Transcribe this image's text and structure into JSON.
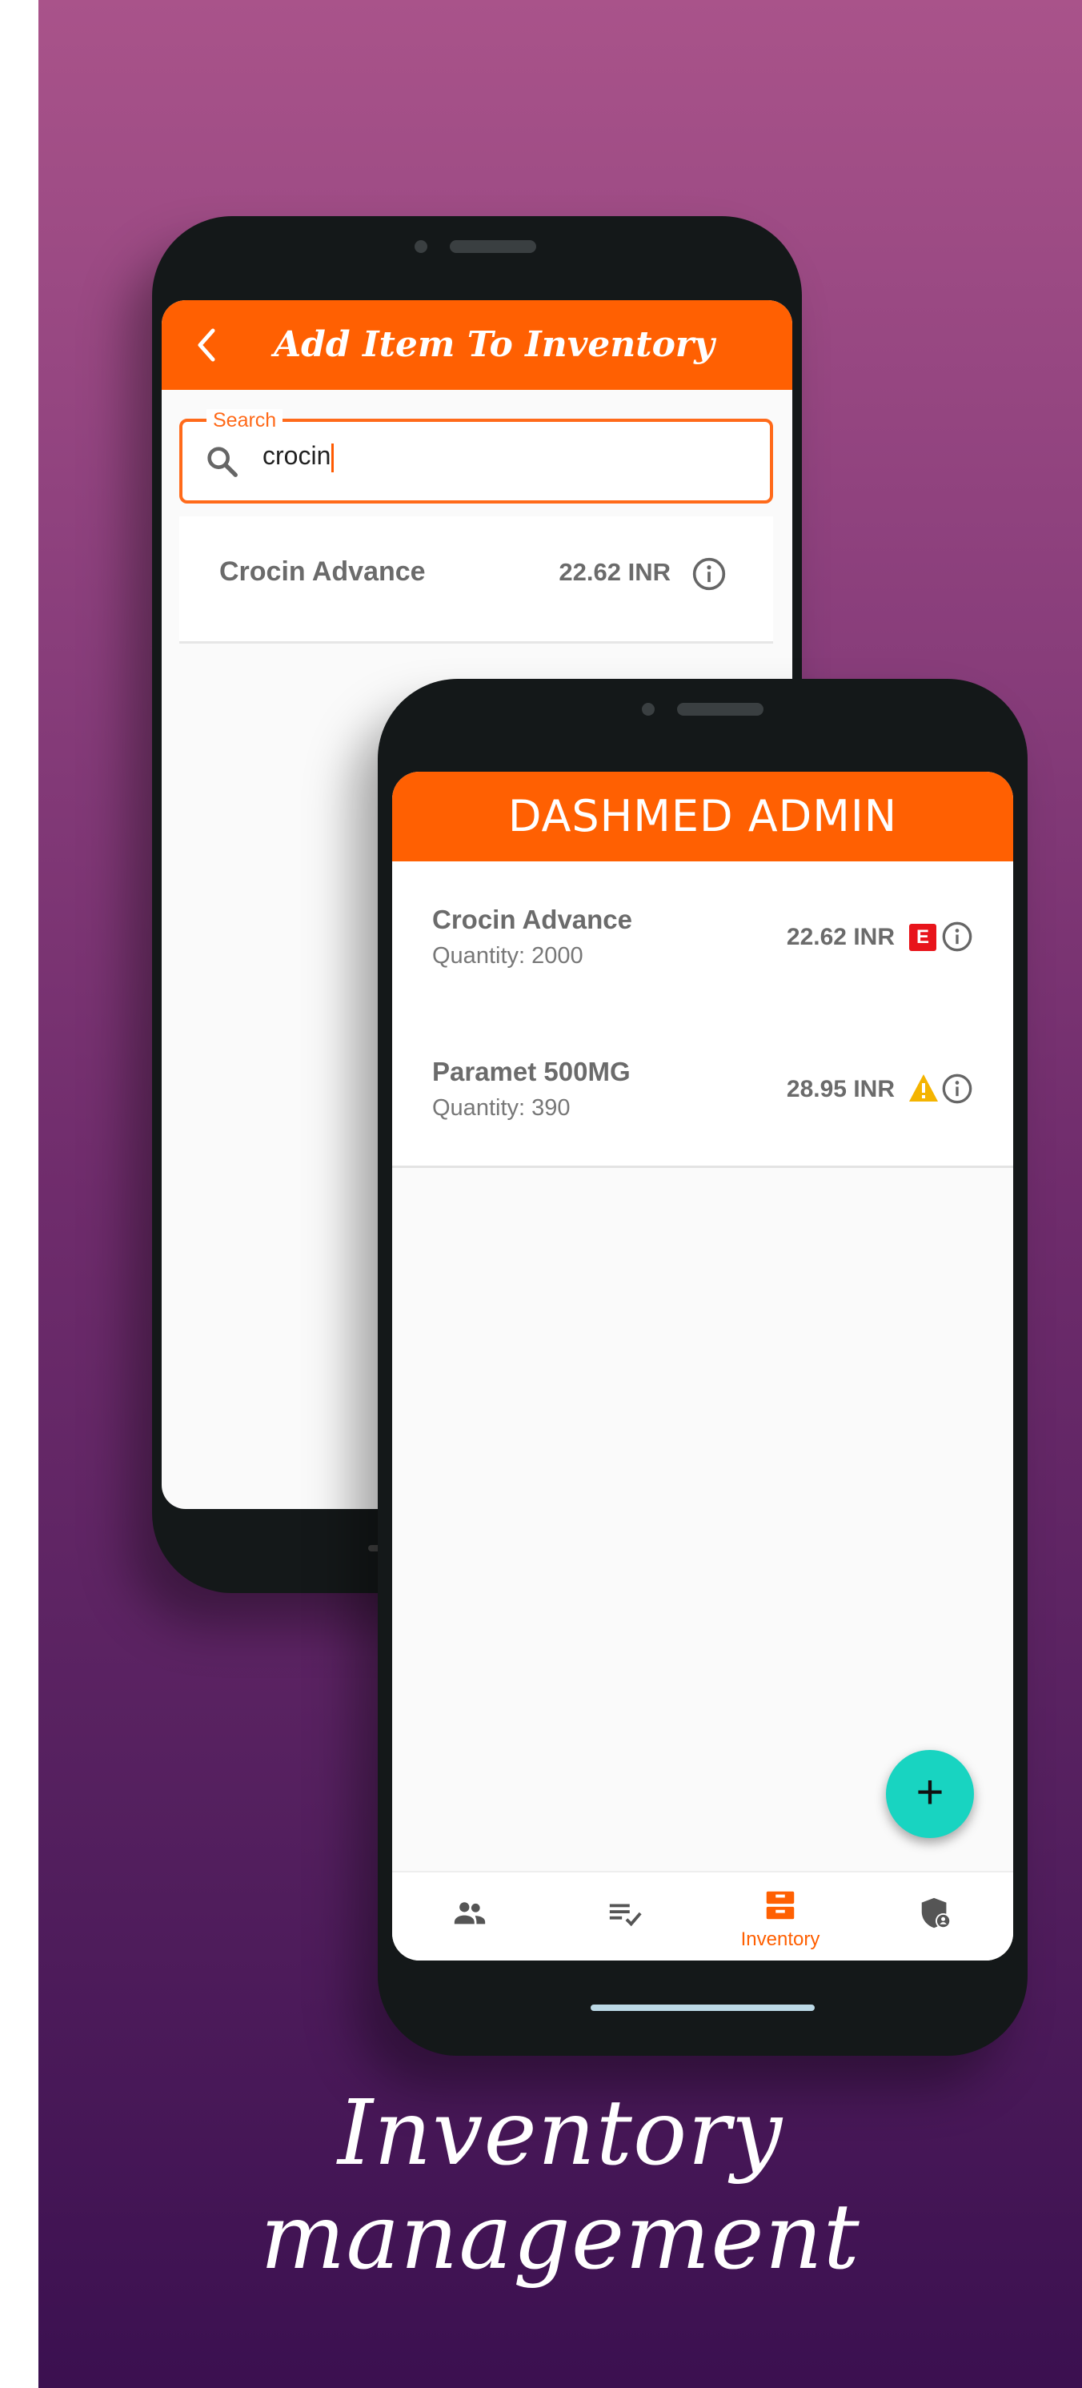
{
  "screen1": {
    "title": "Add Item To Inventory",
    "search": {
      "label": "Search",
      "value": "crocin"
    },
    "results": [
      {
        "name": "Crocin Advance",
        "price": "22.62 INR"
      }
    ]
  },
  "screen2": {
    "title": "DASHMED ADMIN",
    "items": [
      {
        "name": "Crocin Advance",
        "quantity": "Quantity: 2000",
        "price": "22.62 INR",
        "badge": "E",
        "status_icon": "expired-badge-icon"
      },
      {
        "name": "Paramet 500MG",
        "quantity": "Quantity: 390",
        "price": "28.95 INR",
        "status_icon": "warning-icon"
      }
    ],
    "fab_label": "+",
    "nav": [
      {
        "icon": "people-icon"
      },
      {
        "icon": "checklist-icon"
      },
      {
        "icon": "inventory-icon",
        "label": "Inventory",
        "active": true
      },
      {
        "icon": "admin-shield-icon"
      }
    ]
  },
  "caption": "Inventory management",
  "colors": {
    "accent": "#ff6002",
    "fab": "#18d4c1",
    "expired": "#e8141b",
    "warning": "#f4b400"
  }
}
